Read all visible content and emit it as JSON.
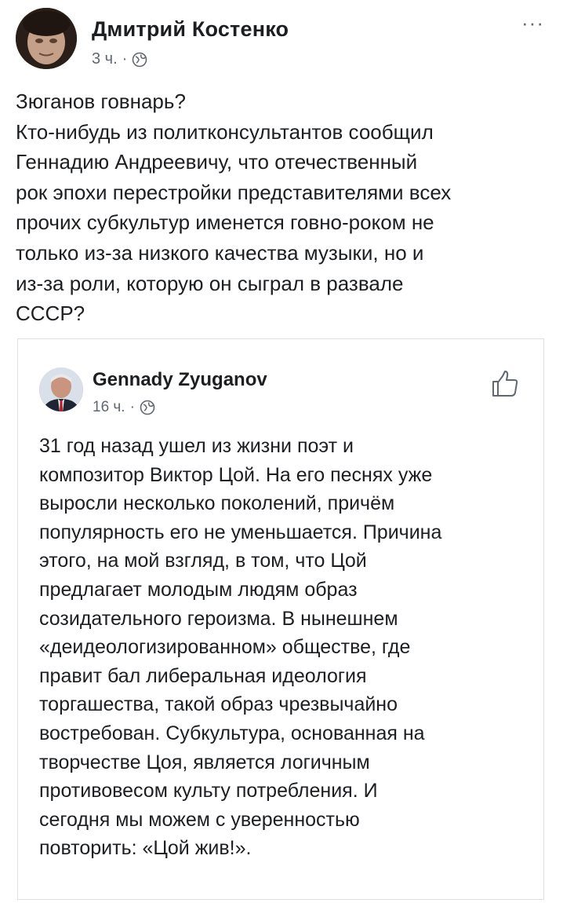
{
  "post": {
    "author": "Дмитрий Костенко",
    "time": "3 ч.",
    "separator": "·",
    "more_label": "···",
    "text_lines": [
      "Зюганов говнарь?",
      "Кто-нибудь  из политконсультантов сообщил",
      "Геннадию  Андреевичу,   что  отечественный",
      "рок эпохи перестройки представителями всех",
      "прочих  субкультур именется говно-роком  не",
      "только  из-за низкого качества  музыки,    но и",
      "из-за роли,  которую он сыграл в развале",
      "СССР?"
    ]
  },
  "shared": {
    "author": "Gennady Zyuganov",
    "time": "16 ч.",
    "separator": "·",
    "text_lines": [
      "31 год назад ушел из жизни поэт и",
      "композитор Виктор Цой. На его песнях уже",
      "выросли несколько поколений, причём",
      "популярность его не уменьшается. Причина",
      "этого, на мой взгляд, в том, что Цой",
      "предлагает молодым людям образ",
      "созидательного героизма. В нынешнем",
      "«деидеологизированном» обществе, где",
      "правит бал либеральная идеология",
      "торгашества, такой образ чрезвычайно",
      "востребован. Субкультура, основанная на",
      "творчестве Цоя, является логичным",
      "противовесом культу потребления. И",
      "сегодня мы можем с уверенностью",
      "повторить: «Цой жив!»."
    ]
  },
  "icons": {
    "globe": "globe-icon",
    "like": "thumbs-up-icon",
    "more": "more-options-icon"
  },
  "colors": {
    "text": "#1c1e21",
    "meta": "#606770",
    "card_border": "#dddfe2"
  }
}
